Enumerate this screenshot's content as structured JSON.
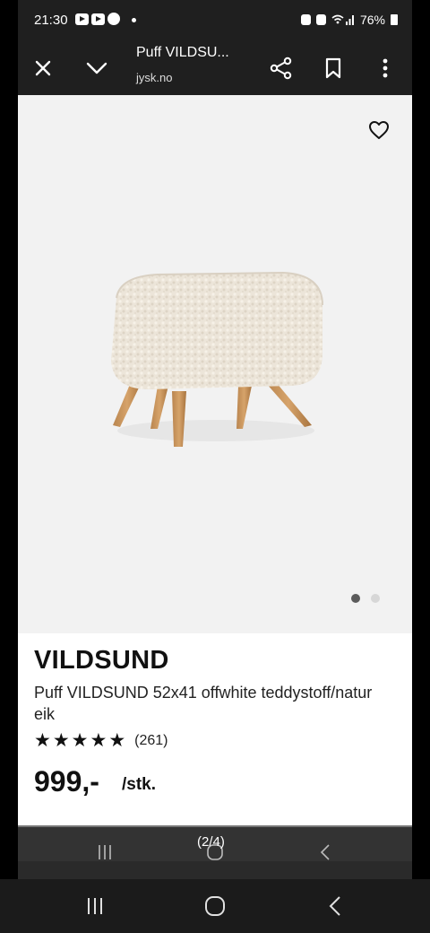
{
  "status_bar": {
    "time": "21:30",
    "battery": "76%"
  },
  "toolbar": {
    "title": "Puff VILDSU...",
    "url": "jysk.no"
  },
  "product": {
    "brand": "VILDSUND",
    "description": "Puff VILDSUND 52x41 offwhite teddystoff/natur eik",
    "rating": 5,
    "rating_count": "(261)",
    "price": "999,-",
    "unit": "/stk."
  },
  "gallery": {
    "current": 1,
    "total": 2
  },
  "pager": {
    "counter": "(2/4)"
  },
  "icons": {
    "close": "close-icon",
    "collapse": "chevron-down-icon",
    "share": "share-icon",
    "bookmark": "bookmark-icon",
    "menu": "more-vert-icon",
    "favorite": "heart-icon"
  },
  "colors": {
    "toolbar_bg": "#1f1f1f",
    "gallery_bg": "#f2f2f2",
    "text": "#111111"
  }
}
